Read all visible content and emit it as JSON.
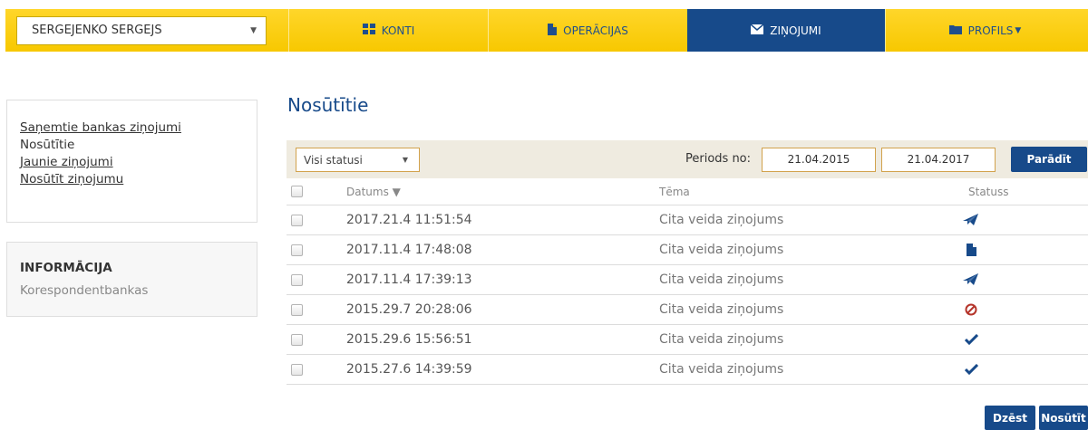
{
  "user_select": {
    "value": "SERGEJENKO SERGEJS"
  },
  "nav": [
    {
      "label": "KONTI",
      "icon": "grid-icon",
      "active": false
    },
    {
      "label": "OPERĀCIJAS",
      "icon": "document-icon",
      "active": false
    },
    {
      "label": "ZIŅOJUMI",
      "icon": "envelope-icon",
      "active": true
    },
    {
      "label": "PROFILS",
      "icon": "folder-icon",
      "active": false
    }
  ],
  "sidebar": {
    "links": [
      {
        "label": "Saņemtie bankas ziņojumi",
        "link": true
      },
      {
        "label": "Nosūtītie",
        "link": false
      },
      {
        "label": "Jaunie ziņojumi",
        "link": true
      },
      {
        "label": "Nosūtīt ziņojumu",
        "link": true
      }
    ],
    "info_title": "INFORMĀCIJA",
    "info_link": "Korespondentbankas"
  },
  "page_title": "Nosūtītie",
  "filter": {
    "status_select": "Visi statusi",
    "period_label": "Periods no:",
    "date_from": "21.04.2015",
    "date_to": "21.04.2017",
    "show_button": "Parādīt"
  },
  "table": {
    "headers": {
      "date": "Datums ▼",
      "topic": "Tēma",
      "status": "Statuss"
    },
    "rows": [
      {
        "date": "2017.21.4 11:51:54",
        "topic": "Cita veida ziņojums",
        "status_icon": "sent-icon"
      },
      {
        "date": "2017.11.4 17:48:08",
        "topic": "Cita veida ziņojums",
        "status_icon": "document-icon"
      },
      {
        "date": "2017.11.4 17:39:13",
        "topic": "Cita veida ziņojums",
        "status_icon": "sent-icon"
      },
      {
        "date": "2015.29.7 20:28:06",
        "topic": "Cita veida ziņojums",
        "status_icon": "rejected-icon"
      },
      {
        "date": "2015.29.6 15:56:51",
        "topic": "Cita veida ziņojums",
        "status_icon": "check-icon"
      },
      {
        "date": "2015.27.6 14:39:59",
        "topic": "Cita veida ziņojums",
        "status_icon": "check-icon"
      }
    ]
  },
  "actions": {
    "delete": "Dzēst",
    "send": "Nosūtīt"
  },
  "colors": {
    "brand_yellow": "#f7c800",
    "brand_blue": "#174a8a",
    "filter_bg": "#efebe0",
    "danger": "#b5342a"
  }
}
